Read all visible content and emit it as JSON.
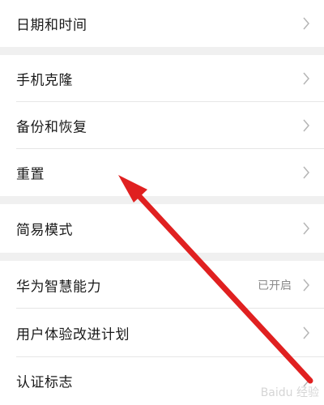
{
  "settings": {
    "groups": [
      {
        "items": [
          {
            "label": "日期和时间"
          }
        ]
      },
      {
        "items": [
          {
            "label": "手机克隆"
          },
          {
            "label": "备份和恢复"
          },
          {
            "label": "重置"
          }
        ]
      },
      {
        "items": [
          {
            "label": "简易模式"
          }
        ]
      },
      {
        "items": [
          {
            "label": "华为智慧能力",
            "status": "已开启"
          },
          {
            "label": "用户体验改进计划"
          },
          {
            "label": "认证标志"
          }
        ]
      }
    ]
  },
  "annotation": {
    "arrow_color": "#e02020"
  },
  "watermark": {
    "text": "Baidu 经验"
  }
}
